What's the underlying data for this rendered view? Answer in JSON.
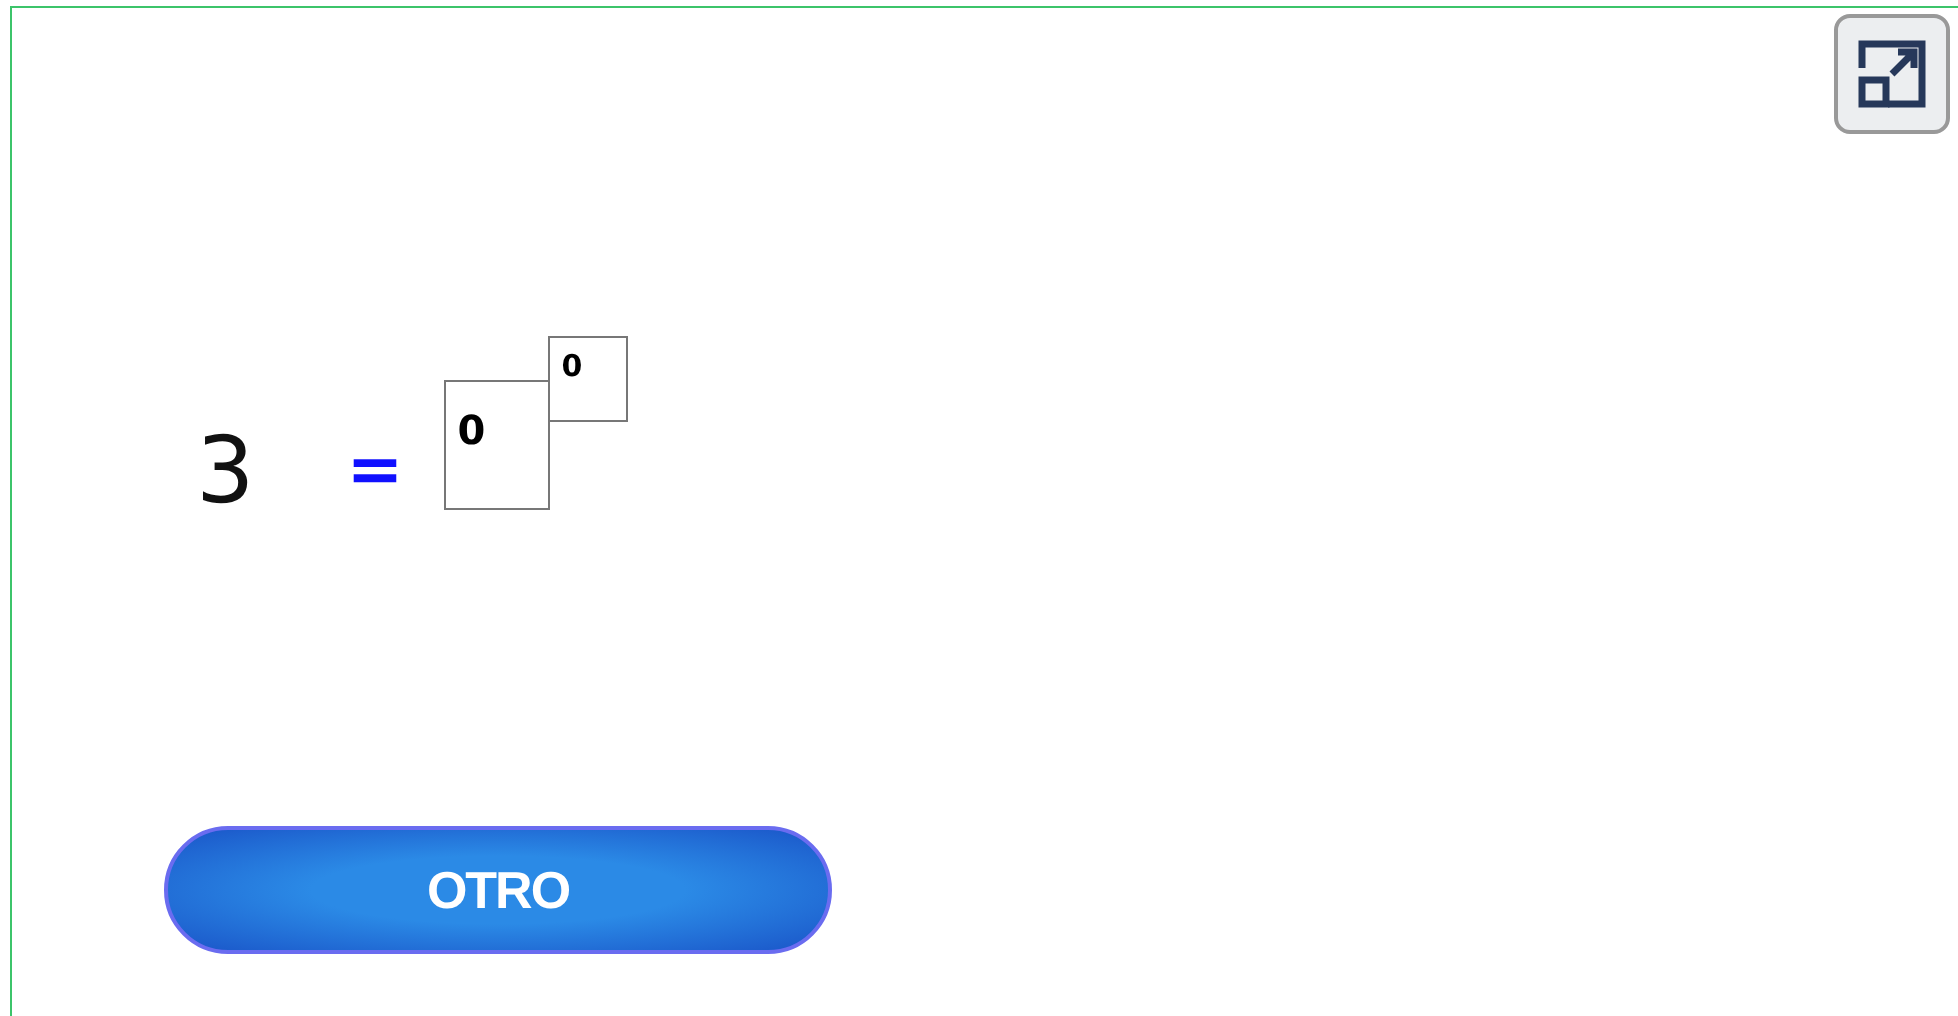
{
  "equation": {
    "number": "3",
    "equals": "=",
    "base": "0",
    "exponent": "0"
  },
  "button": {
    "label": "OTRO"
  }
}
